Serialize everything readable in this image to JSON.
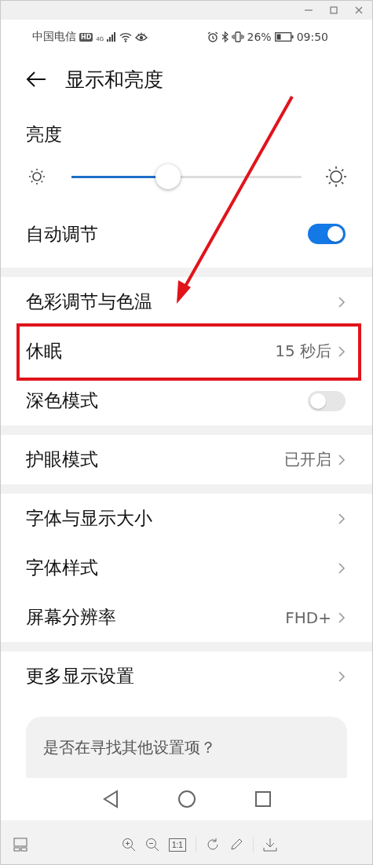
{
  "status_bar": {
    "carrier": "中国电信",
    "hd": "HD",
    "network": "4G",
    "battery": "26%",
    "time": "09:50"
  },
  "header": {
    "title": "显示和亮度"
  },
  "brightness": {
    "label": "亮度",
    "level": 0.42
  },
  "auto_adjust": {
    "label": "自动调节",
    "on": true
  },
  "sections": [
    [
      {
        "kind": "link",
        "label": "色彩调节与色温"
      },
      {
        "kind": "value",
        "label": "休眠",
        "value": "15 秒后",
        "highlighted": true
      },
      {
        "kind": "switch",
        "label": "深色模式",
        "on": false
      }
    ],
    [
      {
        "kind": "value",
        "label": "护眼模式",
        "value": "已开启"
      }
    ],
    [
      {
        "kind": "link",
        "label": "字体与显示大小"
      },
      {
        "kind": "link",
        "label": "字体样式"
      },
      {
        "kind": "value",
        "label": "屏幕分辨率",
        "value": "FHD+"
      }
    ],
    [
      {
        "kind": "link",
        "label": "更多显示设置"
      }
    ]
  ],
  "suggestion_card": {
    "text": "是否在寻找其他设置项？"
  },
  "viewer_toolbar": {
    "actual_size": "1:1"
  }
}
